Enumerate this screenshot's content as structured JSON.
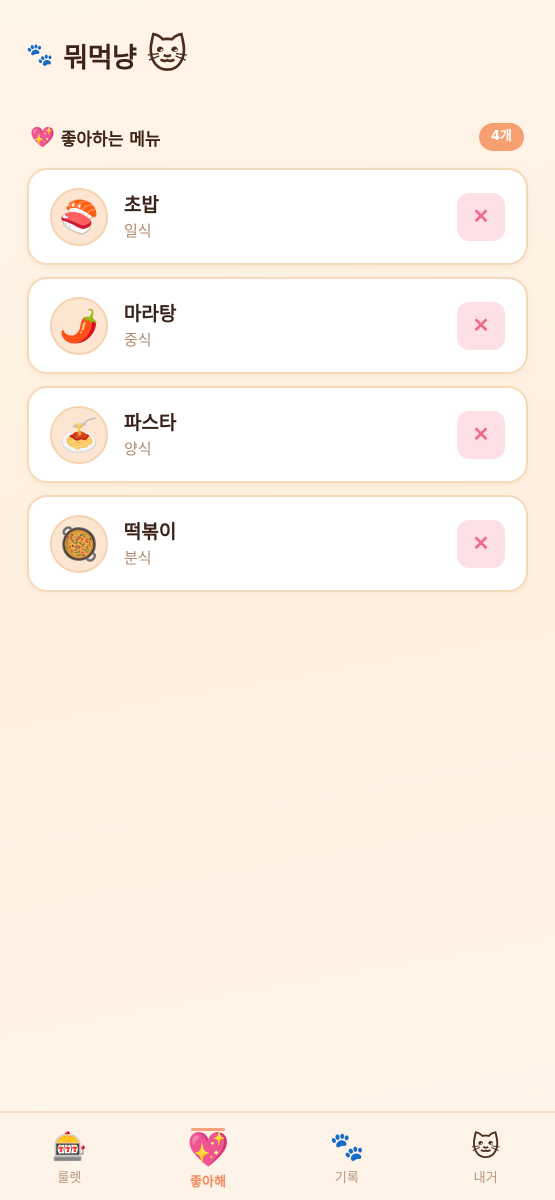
{
  "header": {
    "title": "뭐먹냥",
    "paw_icon": "🐾",
    "cat_icon": "🐱"
  },
  "favorites": {
    "heading": "좋아하는 메뉴",
    "heart_icon": "💖",
    "count_badge": "4개",
    "items": [
      {
        "name": "초밥",
        "category": "일식",
        "icon": "🍣"
      },
      {
        "name": "마라탕",
        "category": "중식",
        "icon": "🌶️"
      },
      {
        "name": "파스타",
        "category": "양식",
        "icon": "🍝"
      },
      {
        "name": "떡볶이",
        "category": "분식",
        "icon": "🥘"
      }
    ],
    "remove_symbol": "✕"
  },
  "tabs": [
    {
      "label": "룰렛",
      "icon": "🎰",
      "active": false
    },
    {
      "label": "좋아해",
      "icon": "💖",
      "active": true
    },
    {
      "label": "기록",
      "icon": "🐾",
      "active": false
    },
    {
      "label": "내거",
      "icon": "🐱",
      "active": false
    }
  ],
  "colors": {
    "accent": "#f6a071",
    "remove_bg": "#fde0e6",
    "remove_fg": "#f06a8a",
    "card_border": "#f5d9b8"
  }
}
